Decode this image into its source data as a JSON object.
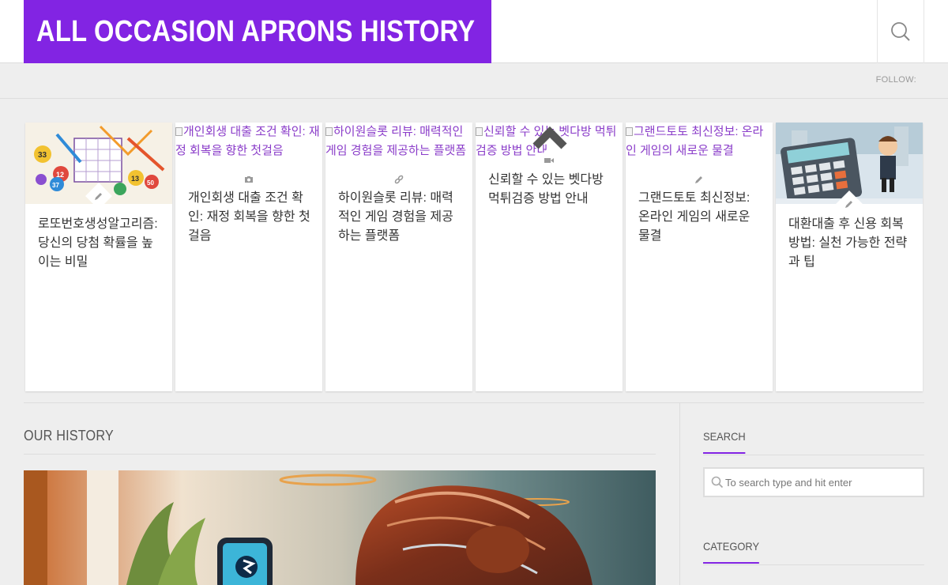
{
  "site": {
    "title": "ALL OCCASION APRONS HISTORY",
    "follow_label": "FOLLOW:"
  },
  "featured": [
    {
      "title": "로또번호생성알고리즘: 당신의 당첨 확률을 높이는 비밀",
      "image_alt": "",
      "format_icon": "pencil-icon",
      "has_image": true
    },
    {
      "title": "개인회생 대출 조건 확인: 재정 회복을 향한 첫걸음",
      "image_alt": "개인회생 대출 조건 확인: 재정 회복을 향한 첫걸음",
      "format_icon": "camera-icon",
      "has_image": false
    },
    {
      "title": "하이원슬롯 리뷰: 매력적인 게임 경험을 제공하는 플랫폼",
      "image_alt": "하이원슬롯 리뷰: 매력적인 게임 경험을 제공하는 플랫폼",
      "format_icon": "link-icon",
      "has_image": false
    },
    {
      "title": "신뢰할 수 있는 벳다방 먹튀검증 방법 안내",
      "image_alt": "신뢰할 수 있는 벳다방 먹튀검증 방법 안내",
      "format_icon": "video-icon",
      "has_image": false
    },
    {
      "title": "그랜드토토 최신정보: 온라인 게임의 새로운 물결",
      "image_alt": "그랜드토토 최신정보: 온라인 게임의 새로운 물결",
      "format_icon": "pencil-icon",
      "has_image": false
    },
    {
      "title": "대환대출 후 신용 회복 방법: 실천 가능한 전략과 팁",
      "image_alt": "",
      "format_icon": "pencil-icon",
      "has_image": true
    }
  ],
  "main": {
    "section_title": "OUR HISTORY"
  },
  "sidebar": {
    "search_title": "SEARCH",
    "search_placeholder": "To search type and hit enter",
    "category_title": "CATEGORY"
  },
  "colors": {
    "accent": "#8224e3",
    "background": "#eeeeee"
  }
}
